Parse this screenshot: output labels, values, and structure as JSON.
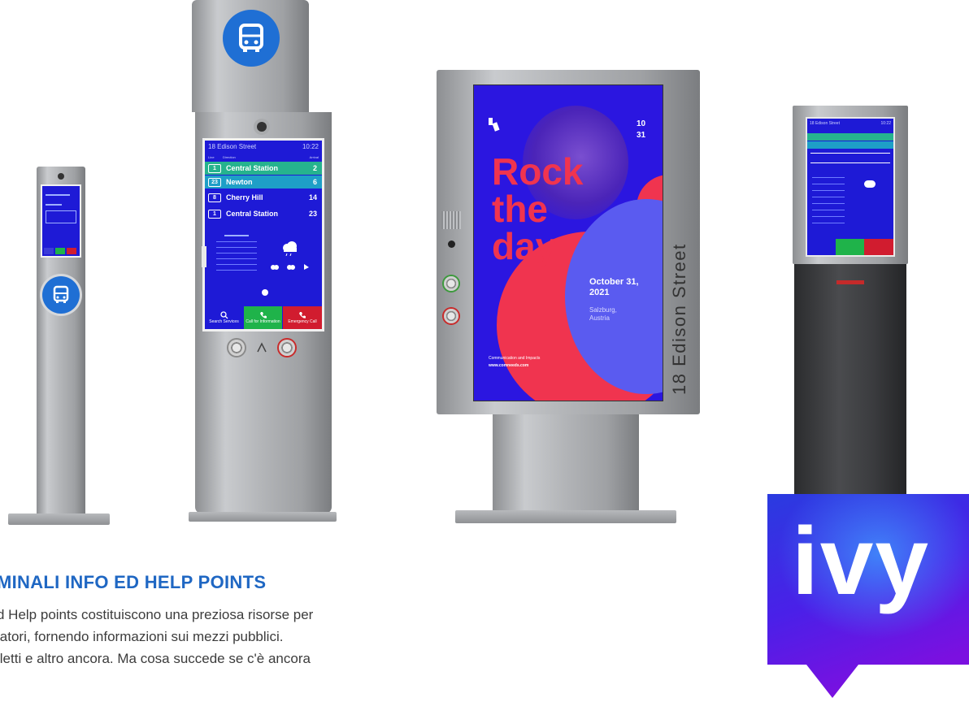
{
  "kiosk_large": {
    "stop_name": "18 Edison Street",
    "time": "10:22",
    "col_line": "Line",
    "col_dest": "Direction",
    "col_min": "Arrival",
    "departures": [
      {
        "line": "1",
        "dest": "Central Station",
        "min": "2"
      },
      {
        "line": "23",
        "dest": "Newton",
        "min": "6"
      },
      {
        "line": "8",
        "dest": "Cherry Hill",
        "min": "14"
      },
      {
        "line": "1",
        "dest": "Central Station",
        "min": "23"
      }
    ],
    "tiles": {
      "search": "Search Services",
      "info": "Call for Information",
      "emergency": "Emergency Call"
    },
    "colors": {
      "screen": "#1e1ad6",
      "first_row": "#26b38e",
      "second_row": "#1e9fc7",
      "info": "#1fb34a",
      "emergency": "#d11c2f"
    }
  },
  "poster": {
    "date_top": "10",
    "date_bottom": "31",
    "line1": "Rock",
    "line2": "the",
    "line3": "day",
    "date": "October 31, 2021",
    "place1": "Salzburg,",
    "place2": "Austria",
    "footer1": "Communication and Impacts",
    "footer2": "www.comneeds.com",
    "colors": {
      "bg": "#2b16e0",
      "purple": "#6a3fbf",
      "red": "#f0344f",
      "circle": "#5a5bf0"
    }
  },
  "side_sign": "18 Edison Street",
  "logo": {
    "text": "ivy",
    "colors": {
      "top": "#2a3be0",
      "mid": "#4a20e8",
      "bottom": "#7b10e0"
    }
  },
  "heading": "MINALI INFO ED HELP POINTS",
  "paragraph": [
    "d Help points costituiscono una preziosa risorse per",
    "iatori, fornendo informazioni sui mezzi pubblici.",
    "iletti e altro ancora. Ma cosa succede se c'è ancora"
  ]
}
